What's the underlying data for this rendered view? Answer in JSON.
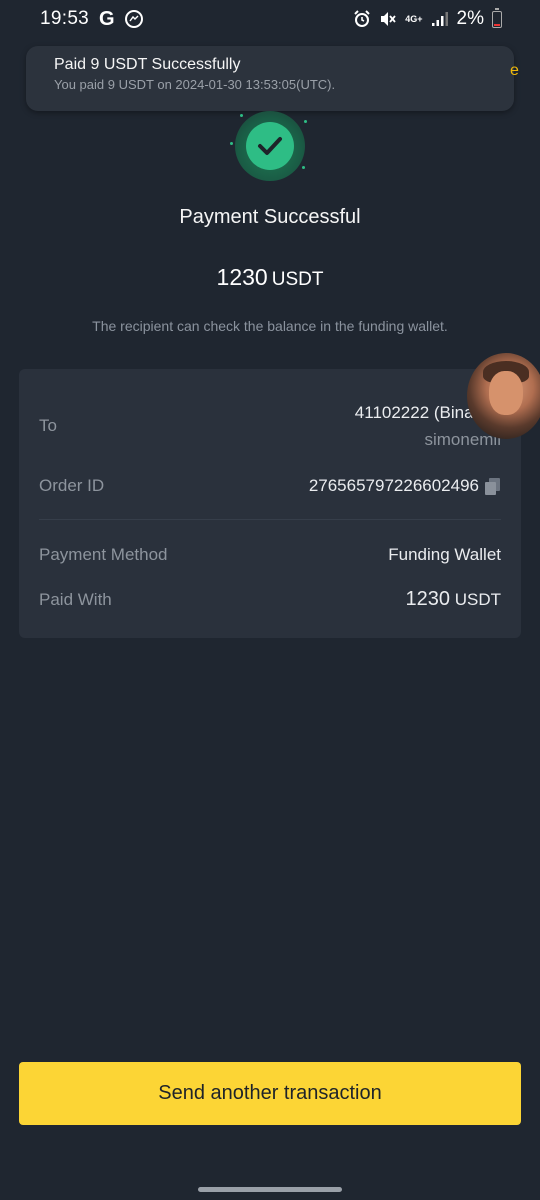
{
  "status_bar": {
    "time": "19:53",
    "network": "4G+",
    "battery": "2%"
  },
  "notification": {
    "title": "Paid 9 USDT Successfully",
    "body": "You paid 9 USDT on 2024-01-30 13:53:05(UTC).",
    "edge_char": "e"
  },
  "result": {
    "title": "Payment Successful",
    "amount": "1230",
    "currency": "USDT",
    "subtitle": "The recipient can check the balance in the funding wallet."
  },
  "details": {
    "to_label": "To",
    "to_value": "41102222 (Binance",
    "to_sub": "simonemil",
    "order_label": "Order ID",
    "order_value": "276565797226602496",
    "method_label": "Payment Method",
    "method_value": "Funding Wallet",
    "paid_label": "Paid With",
    "paid_amount": "1230",
    "paid_currency": "USDT"
  },
  "actions": {
    "send_another": "Send another transaction"
  },
  "colors": {
    "background": "#1f2630",
    "card": "#2a313c",
    "accent": "#fcd535",
    "success": "#2ebd85"
  }
}
